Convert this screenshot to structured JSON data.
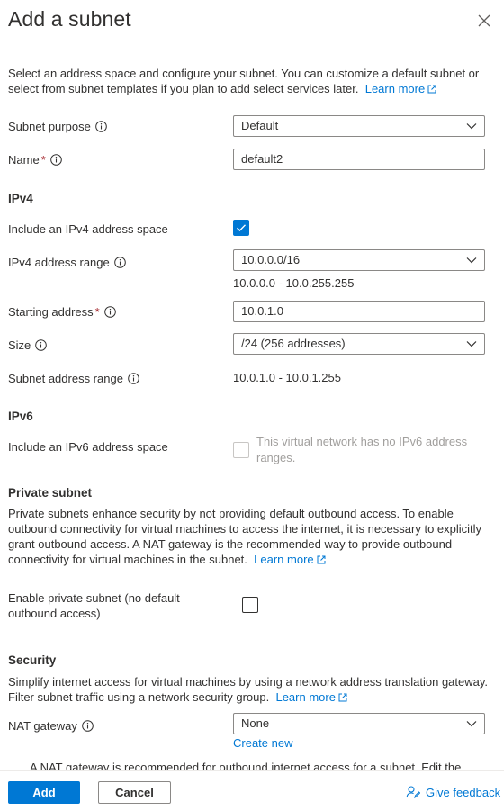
{
  "header": {
    "title": "Add a subnet"
  },
  "intro": {
    "text": "Select an address space and configure your subnet. You can customize a default subnet or select from subnet templates if you plan to add select services later.",
    "learn_more": "Learn more"
  },
  "fields": {
    "subnet_purpose": {
      "label": "Subnet purpose",
      "value": "Default"
    },
    "name": {
      "label": "Name",
      "required_mark": "*",
      "value": "default2"
    }
  },
  "ipv4": {
    "heading": "IPv4",
    "include_label": "Include an IPv4 address space",
    "include_checked": true,
    "range_label": "IPv4 address range",
    "range_value": "10.0.0.0/16",
    "range_hint": "10.0.0.0 - 10.0.255.255",
    "start_label": "Starting address",
    "start_required_mark": "*",
    "start_value": "10.0.1.0",
    "size_label": "Size",
    "size_value": "/24 (256 addresses)",
    "subnet_range_label": "Subnet address range",
    "subnet_range_value": "10.0.1.0 - 10.0.1.255"
  },
  "ipv6": {
    "heading": "IPv6",
    "include_label": "Include an IPv6 address space",
    "disabled_text": "This virtual network has no IPv6 address ranges."
  },
  "private_subnet": {
    "heading": "Private subnet",
    "text": "Private subnets enhance security by not providing default outbound access. To enable outbound connectivity for virtual machines to access the internet, it is necessary to explicitly grant outbound access. A NAT gateway is the recommended way to provide outbound connectivity for virtual machines in the subnet.",
    "learn_more": "Learn more",
    "enable_label_line1": "Enable private subnet (no default",
    "enable_label_line2": "outbound access)",
    "enable_checked": false
  },
  "security": {
    "heading": "Security",
    "text": "Simplify internet access for virtual machines by using a network address translation gateway. Filter subnet traffic using a network security group.",
    "learn_more": "Learn more",
    "nat_label": "NAT gateway",
    "nat_value": "None",
    "create_new": "Create new",
    "clipped_note": "A NAT gateway is recommended for outbound internet access for a subnet. Edit the"
  },
  "footer": {
    "add_label": "Add",
    "cancel_label": "Cancel",
    "feedback_label": "Give feedback"
  },
  "colors": {
    "accent": "#0078d4",
    "text": "#323130",
    "required": "#a4262c",
    "disabled": "#a19f9d"
  }
}
